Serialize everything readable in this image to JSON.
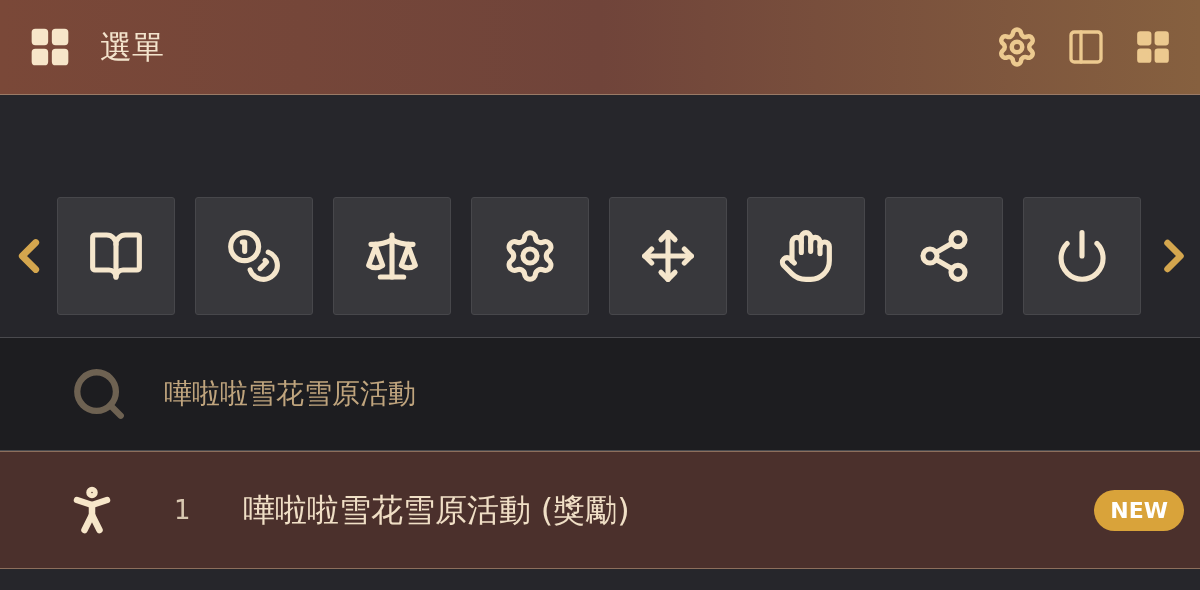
{
  "header": {
    "title": "選單"
  },
  "shortcuts": [
    {
      "kind": "book"
    },
    {
      "kind": "coins"
    },
    {
      "kind": "scale"
    },
    {
      "kind": "gear"
    },
    {
      "kind": "move"
    },
    {
      "kind": "hand"
    },
    {
      "kind": "network"
    },
    {
      "kind": "power"
    }
  ],
  "search": {
    "value": "嘩啦啦雪花雪原活動"
  },
  "results": [
    {
      "index": "1",
      "title": "嘩啦啦雪花雪原活動 (獎勵)",
      "badge": "NEW"
    }
  ]
}
